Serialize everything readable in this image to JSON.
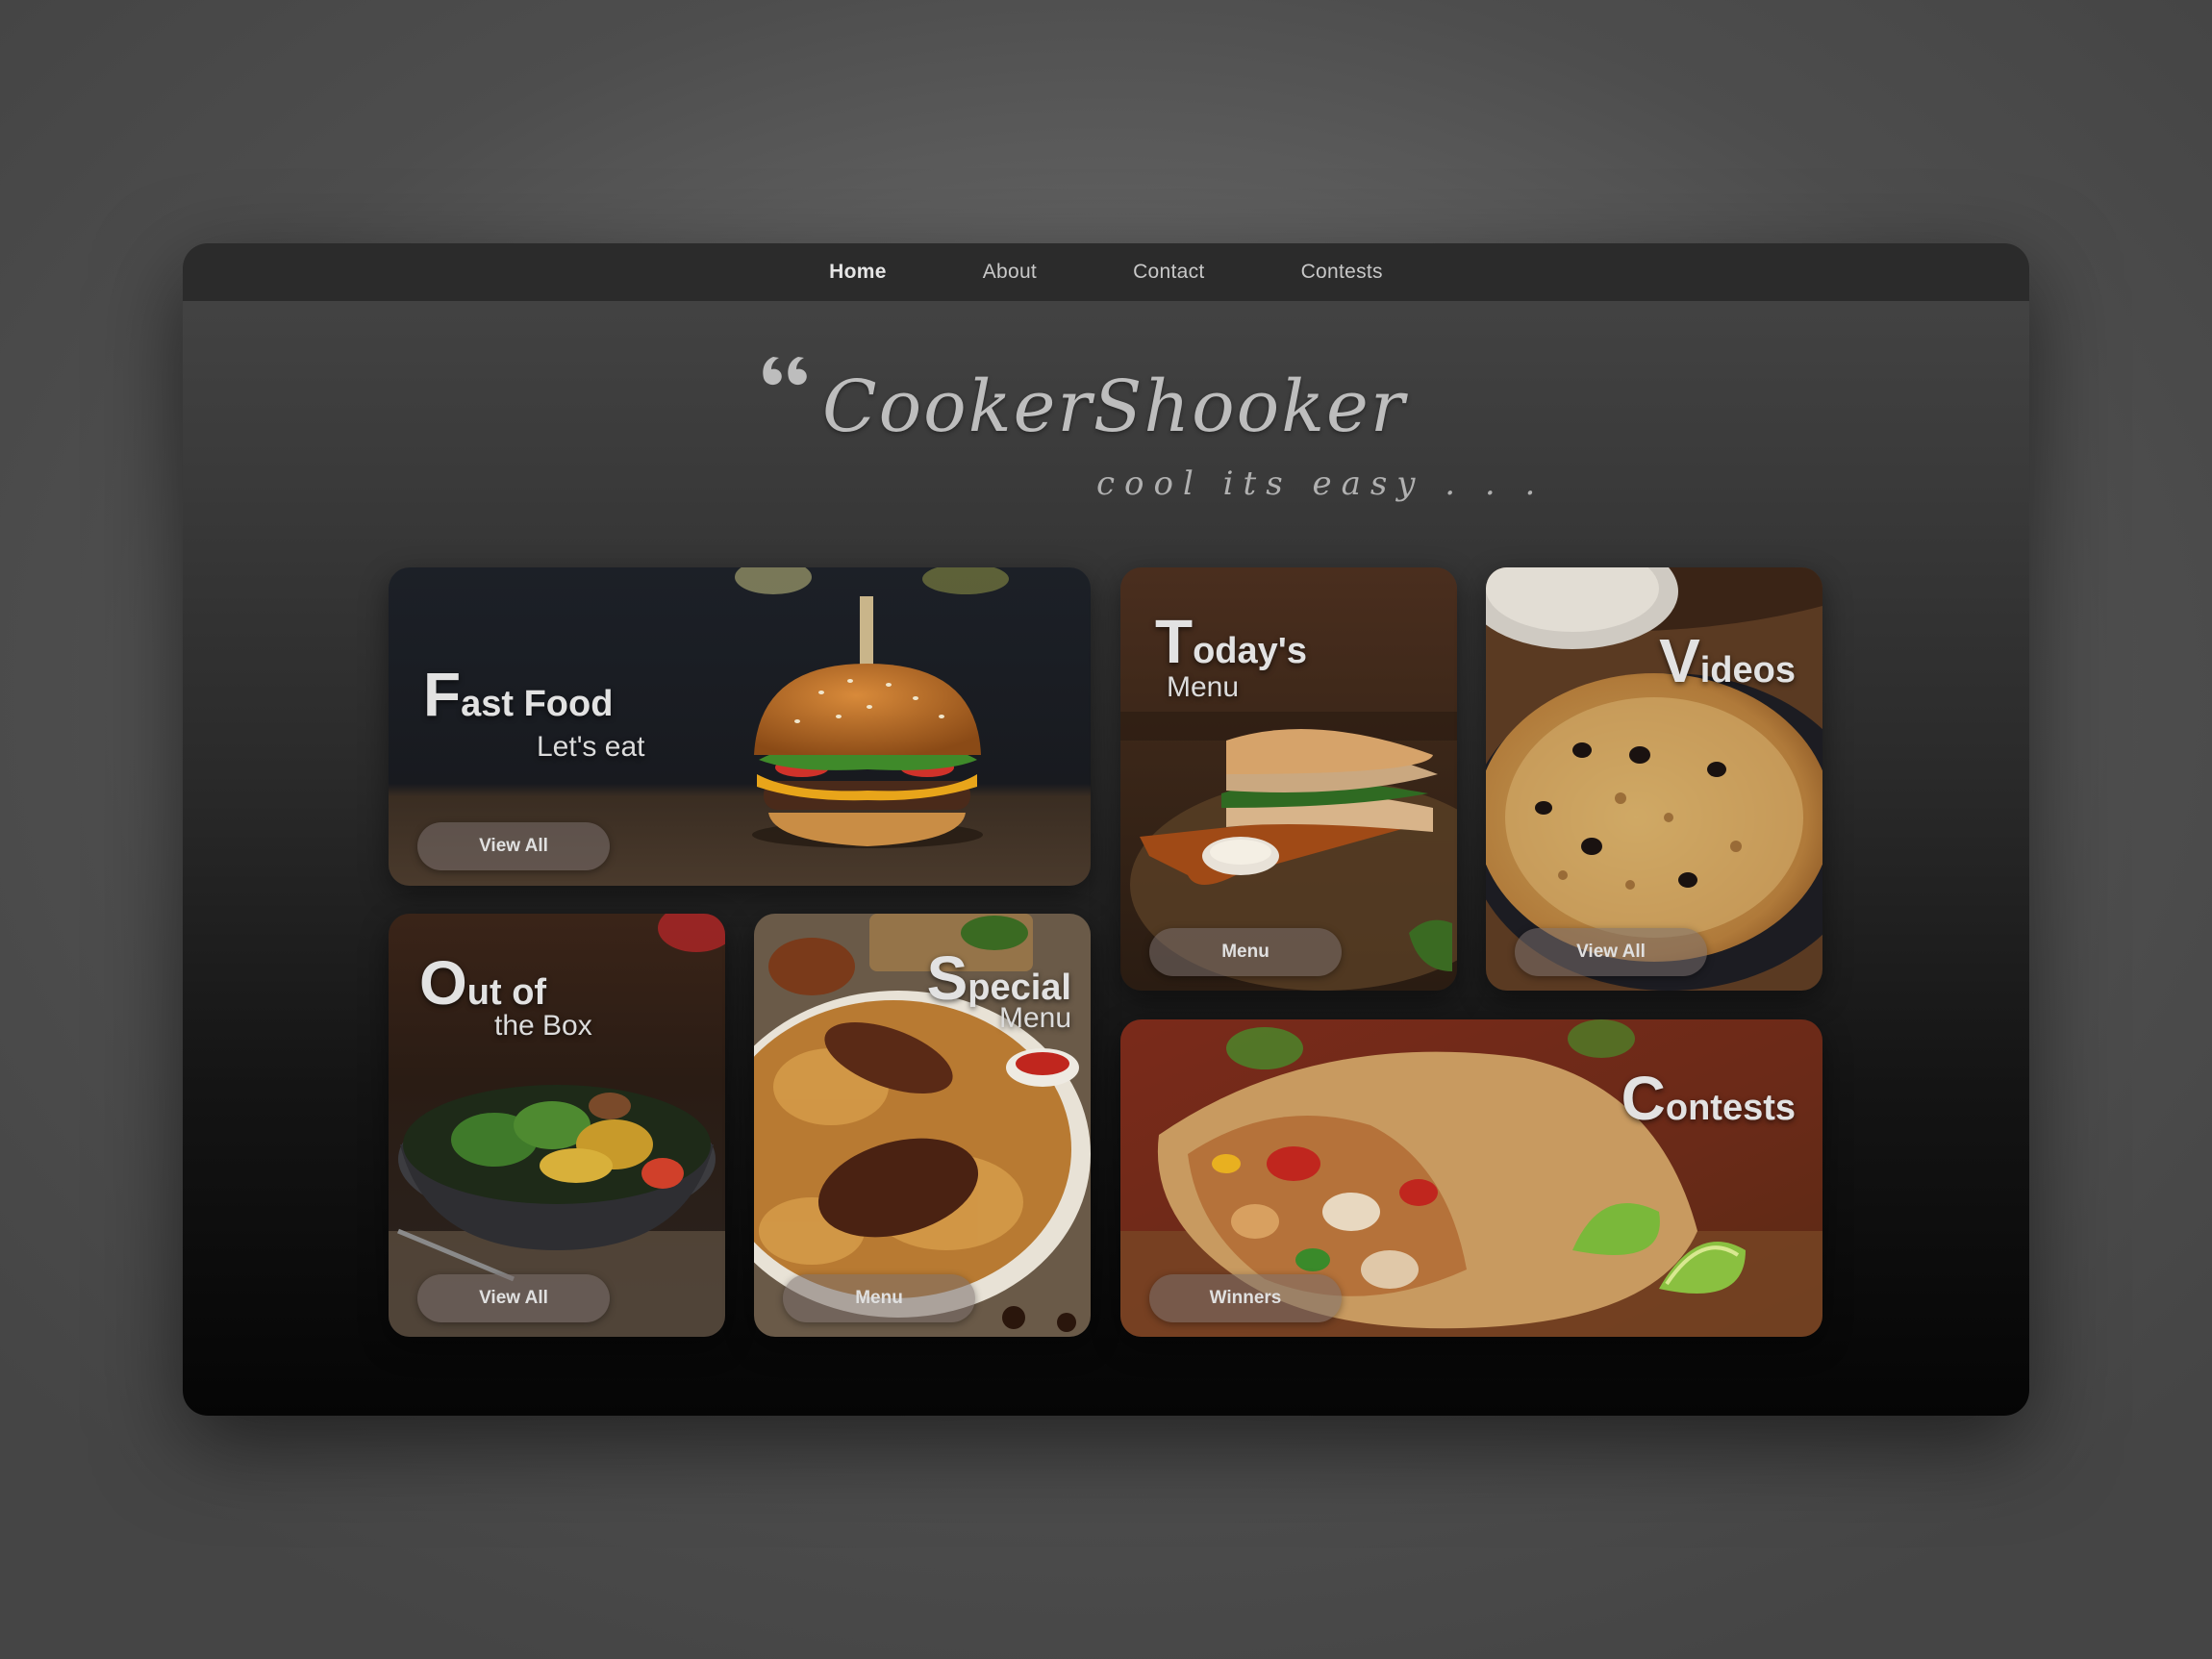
{
  "nav": {
    "items": [
      {
        "label": "Home",
        "active": true
      },
      {
        "label": "About",
        "active": false
      },
      {
        "label": "Contact",
        "active": false
      },
      {
        "label": "Contests",
        "active": false
      }
    ]
  },
  "brand": {
    "title": "CookerShooker",
    "tagline": "cool its easy . . ."
  },
  "cards": {
    "fast_food": {
      "title_cap": "F",
      "title_rest": "ast Food",
      "subtitle": "Let's eat",
      "button": "View All",
      "image": "burger"
    },
    "todays_menu": {
      "title_cap": "T",
      "title_rest": "oday's",
      "subtitle": "Menu",
      "button": "Menu",
      "image": "sandwich"
    },
    "videos": {
      "title_cap": "V",
      "title_rest": "ideos",
      "button": "View All",
      "image": "pizza"
    },
    "out_of_box": {
      "title_cap": "O",
      "title_rest": "ut of",
      "subtitle": "the Box",
      "button": "View All",
      "image": "salad-bowl"
    },
    "special_menu": {
      "title_cap": "S",
      "title_rest": "pecial",
      "subtitle": "Menu",
      "button": "Menu",
      "image": "biryani"
    },
    "contests": {
      "title_cap": "C",
      "title_rest": "ontests",
      "button": "Winners",
      "image": "burrito"
    }
  },
  "colors": {
    "navbar_bg": "#2b2b2b",
    "card_button_bg": "#786e6c",
    "text_light": "#e2e2e2"
  }
}
